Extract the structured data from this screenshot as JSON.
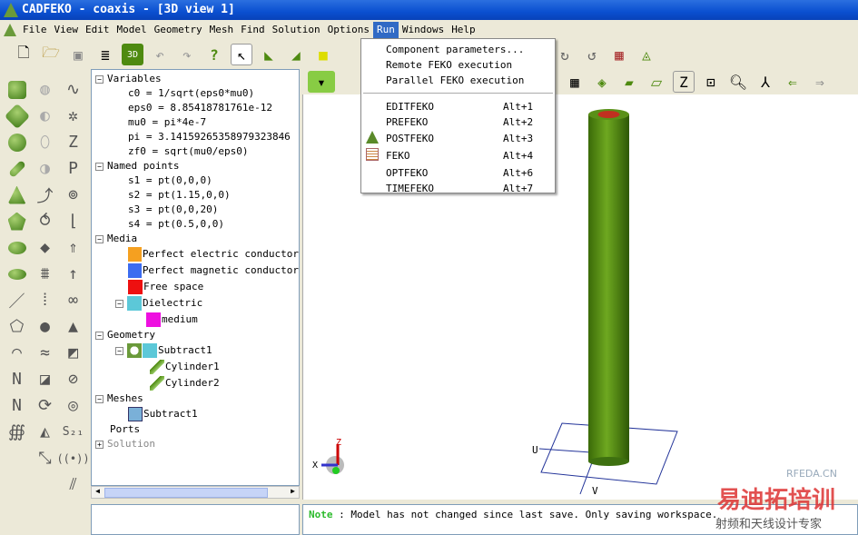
{
  "window": {
    "title": "CADFEKO - coaxis - [3D view 1]"
  },
  "menu": [
    "File",
    "View",
    "Edit",
    "Model",
    "Geometry",
    "Mesh",
    "Find",
    "Solution",
    "Options",
    "Run",
    "Windows",
    "Help"
  ],
  "run_menu": {
    "top": [
      "Component parameters...",
      "Remote FEKO execution",
      "Parallel FEKO execution"
    ],
    "items": [
      {
        "label": "EDITFEKO",
        "shortcut": "Alt+1",
        "icon": ""
      },
      {
        "label": "PREFEKO",
        "shortcut": "Alt+2",
        "icon": ""
      },
      {
        "label": "POSTFEKO",
        "shortcut": "Alt+3",
        "icon": "postfeko-icon"
      },
      {
        "label": "FEKO",
        "shortcut": "Alt+4",
        "icon": "feko-icon"
      },
      {
        "label": "OPTFEKO",
        "shortcut": "Alt+6",
        "icon": ""
      },
      {
        "label": "TIMEFEKO",
        "shortcut": "Alt+7",
        "icon": ""
      }
    ]
  },
  "tree": {
    "variables": {
      "label": "Variables",
      "items": [
        "c0 = 1/sqrt(eps0*mu0)",
        "eps0 = 8.85418781761e-12",
        "mu0 = pi*4e-7",
        "pi = 3.14159265358979323846",
        "zf0 = sqrt(mu0/eps0)"
      ]
    },
    "named_points": {
      "label": "Named points",
      "items": [
        "s1 = pt(0,0,0)",
        "s2 = pt(1.15,0,0)",
        "s3 = pt(0,0,20)",
        "s4 = pt(0.5,0,0)"
      ]
    },
    "media": {
      "label": "Media",
      "items": [
        {
          "label": "Perfect electric conductor",
          "color": "#f5a020"
        },
        {
          "label": "Perfect magnetic conductor",
          "color": "#3c6cf0"
        },
        {
          "label": "Free space",
          "color": "#ee1010"
        },
        {
          "label": "Dielectric",
          "color": "#5cc8d8"
        },
        {
          "label": "medium",
          "color": "#ee10e0"
        }
      ]
    },
    "geometry": {
      "label": "Geometry",
      "items": [
        "Subtract1",
        "Cylinder1",
        "Cylinder2"
      ]
    },
    "meshes": {
      "label": "Meshes",
      "items": [
        "Subtract1"
      ]
    },
    "ports": "Ports",
    "solution": "Solution"
  },
  "view": {
    "axes": {
      "x": "X",
      "z": "Z"
    },
    "plane": {
      "u": "U",
      "v": "V"
    },
    "model_color": "#4e8a10"
  },
  "message": {
    "tag": "Note",
    "text": ": Model has not changed since last save. Only saving workspace."
  },
  "watermark": {
    "site": "RFEDA.CN",
    "brand": "易迪拓培训",
    "slogan": "射频和天线设计专家"
  }
}
